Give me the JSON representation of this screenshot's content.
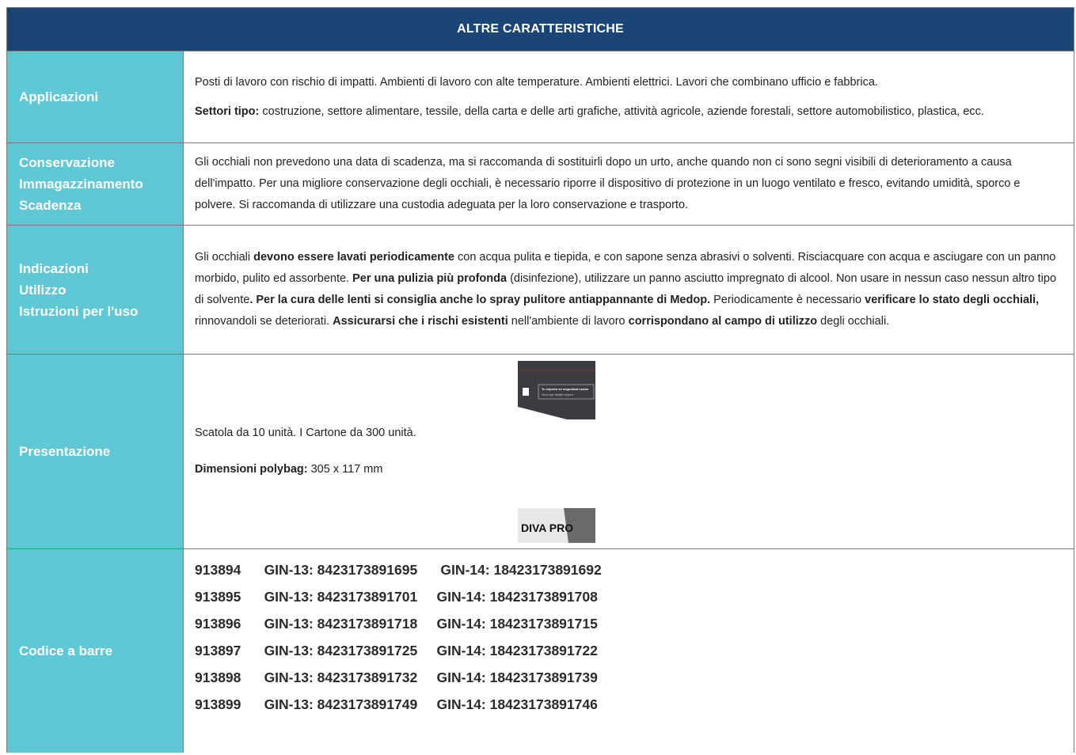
{
  "header": {
    "title": "ALTRE CARATTERISTICHE"
  },
  "rows": {
    "applicazioni": {
      "label": "Applicazioni",
      "p1": "Posti di lavoro con rischio di impatti. Ambienti di lavoro con alte temperature. Ambienti elettrici. Lavori che combinano ufficio e fabbrica.",
      "p2_bold": "Settori tipo:",
      "p2_rest": " costruzione, settore alimentare, tessile, della carta e delle arti grafiche, attività agricole, aziende forestali, settore automobilistico, plastica, ecc."
    },
    "conservazione": {
      "label1": "Conservazione",
      "label2": "Immagazzinamento",
      "label3": "Scadenza",
      "text": "Gli occhiali non prevedono una data di scadenza, ma si raccomanda di sostituirli dopo un urto, anche quando non ci sono segni visibili di deterioramento a causa dell'impatto. Per una migliore conservazione degli occhiali, è necessario riporre il dispositivo di protezione in un luogo ventilato e fresco, evitando umidità, sporco e polvere. Si raccomanda di utilizzare una custodia adeguata per la loro conservazione e trasporto."
    },
    "indicazioni": {
      "label1": "Indicazioni",
      "label2": "Utilizzo",
      "label3": "Istruzioni per l'uso",
      "t1": "Gli occhiali ",
      "b1": "devono essere lavati periodicamente",
      "t2": " con acqua pulita e tiepida, e con sapone senza abrasivi o solventi. Risciacquare con acqua e asciugare con un panno morbido, pulito ed assorbente. ",
      "b2": "Per una pulizia più profonda",
      "t3": " (disinfezione), utilizzare un panno asciutto impregnato di alcool. Non usare in nessun caso nessun altro tipo di solvente",
      "b3": ". Per la cura delle lenti si consiglia anche lo spray pulitore antiappannante di Medop.",
      "t4": " Periodicamente è necessario ",
      "b4": "verificare lo stato degli occhiali,",
      "t5": " rinnovandoli se deteriorati. ",
      "b5": "Assicurarsi che i rischi esistenti",
      "t6": " nell'ambiente di lavoro ",
      "b6": "corrispondano al campo di utilizzo",
      "t7": " degli occhiali."
    },
    "presentazione": {
      "label": "Presentazione",
      "p1": "Scatola da 10 unità.  I  Cartone da 300 unità.",
      "p2_bold": "Dimensioni polybag:",
      "p2_rest": " 305 x 117 mm",
      "pkg_text1": "Tu experto en seguridad ocular",
      "pkg_text2": "Your eye health expert",
      "logo_text": "DIVA PRO"
    },
    "codice": {
      "label": "Codice a barre",
      "lines": [
        "913894      GIN-13: 8423173891695      GIN-14: 18423173891692",
        "913895      GIN-13: 8423173891701     GIN-14: 18423173891708",
        "913896      GIN-13: 8423173891718     GIN-14: 18423173891715",
        "913897      GIN-13: 8423173891725     GIN-14: 18423173891722",
        "913898      GIN-13: 8423173891732     GIN-14: 18423173891739",
        "913899      GIN-13: 8423173891749     GIN-14: 18423173891746"
      ]
    }
  },
  "colors": {
    "header_bg": "#1b4577",
    "label_bg": "#5fc8d4"
  }
}
